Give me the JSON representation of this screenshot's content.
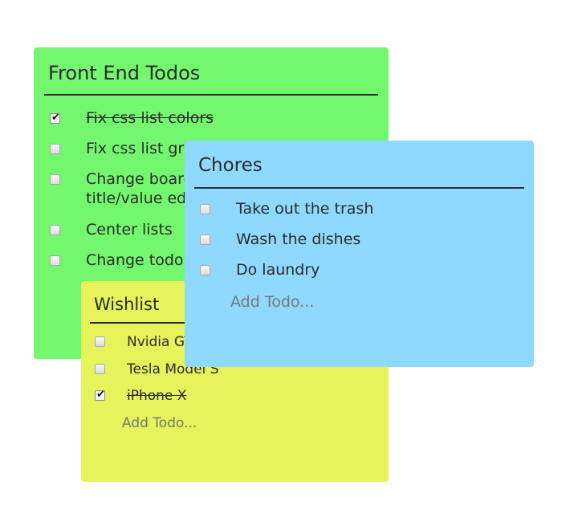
{
  "boards": {
    "front": {
      "title": "Front End Todos",
      "color": "#73f76e",
      "items": [
        {
          "label": "Fix css list colors",
          "checked": true
        },
        {
          "label": "Fix css list gr",
          "checked": false
        },
        {
          "label": "Change board",
          "label2": "title/value ed",
          "checked": false
        },
        {
          "label": "Center lists",
          "checked": false
        },
        {
          "label": "Change todo",
          "checked": false
        }
      ]
    },
    "wishlist": {
      "title": "Wishlist",
      "color": "#e6f35a",
      "items": [
        {
          "label": "Nvidia GT",
          "checked": false
        },
        {
          "label": "Tesla Model S",
          "checked": false
        },
        {
          "label": "iPhone X",
          "checked": true
        }
      ],
      "add_placeholder": "Add Todo..."
    },
    "chores": {
      "title": "Chores",
      "color": "#8ed9fd",
      "items": [
        {
          "label": "Take out the trash",
          "checked": false
        },
        {
          "label": "Wash the dishes",
          "checked": false
        },
        {
          "label": "Do laundry",
          "checked": false
        }
      ],
      "add_placeholder": "Add Todo..."
    }
  },
  "icons": {
    "checkmark": "checkmark-icon"
  }
}
